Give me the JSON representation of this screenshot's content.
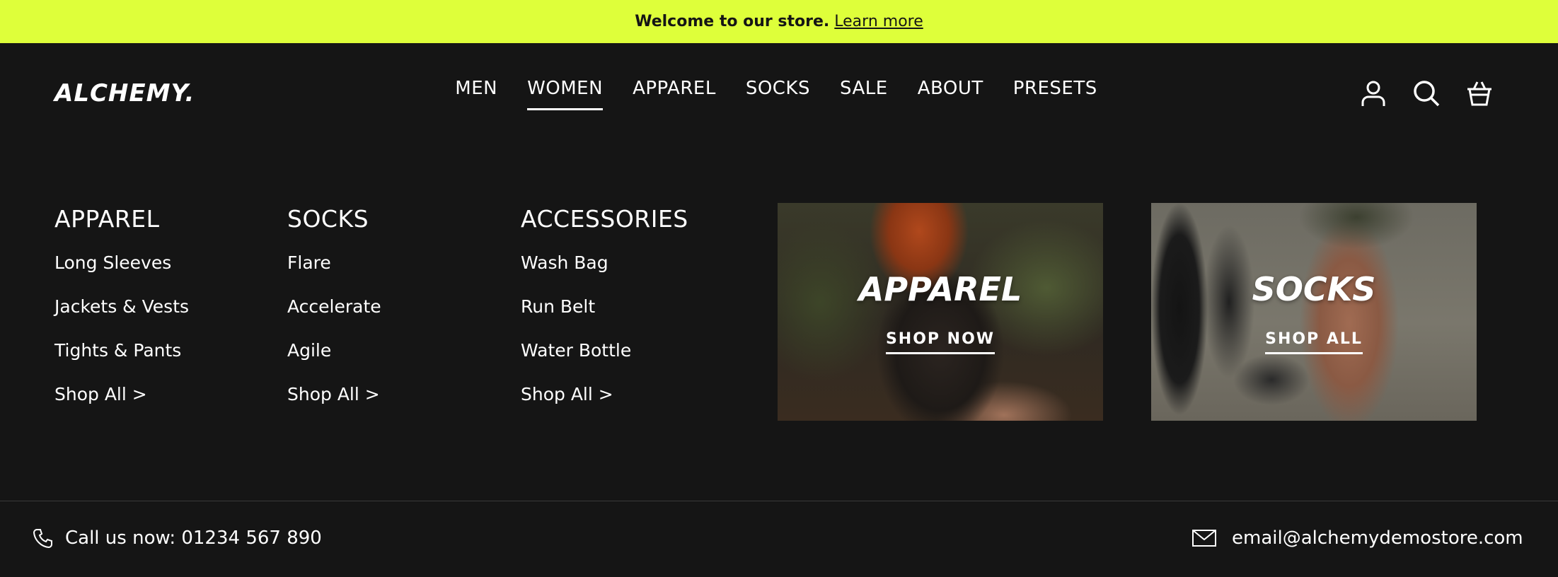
{
  "announcement": {
    "message": "Welcome to our store.",
    "link": "Learn more"
  },
  "header": {
    "logo": "ALCHEMY.",
    "nav": [
      "MEN",
      "WOMEN",
      "APPAREL",
      "SOCKS",
      "SALE",
      "ABOUT",
      "PRESETS"
    ],
    "active_nav": "WOMEN",
    "icons": [
      "account-icon",
      "search-icon",
      "basket-icon"
    ]
  },
  "menu": {
    "columns": [
      {
        "title": "APPAREL",
        "links": [
          "Long Sleeves",
          "Jackets & Vests",
          "Tights & Pants",
          "Shop All >"
        ]
      },
      {
        "title": "SOCKS",
        "links": [
          "Flare",
          "Accelerate",
          "Agile",
          "Shop All >"
        ]
      },
      {
        "title": "ACCESSORIES",
        "links": [
          "Wash Bag",
          "Run Belt",
          "Water Bottle",
          "Shop All >"
        ]
      }
    ],
    "cards": [
      {
        "title": "APPAREL",
        "cta": "SHOP NOW"
      },
      {
        "title": "SOCKS",
        "cta": "SHOP ALL"
      }
    ]
  },
  "footer": {
    "phone": "Call us now: 01234 567 890",
    "email": "email@alchemydemostore.com"
  },
  "colors": {
    "accent": "#deff3a",
    "background": "#151515",
    "text": "#ffffff"
  }
}
